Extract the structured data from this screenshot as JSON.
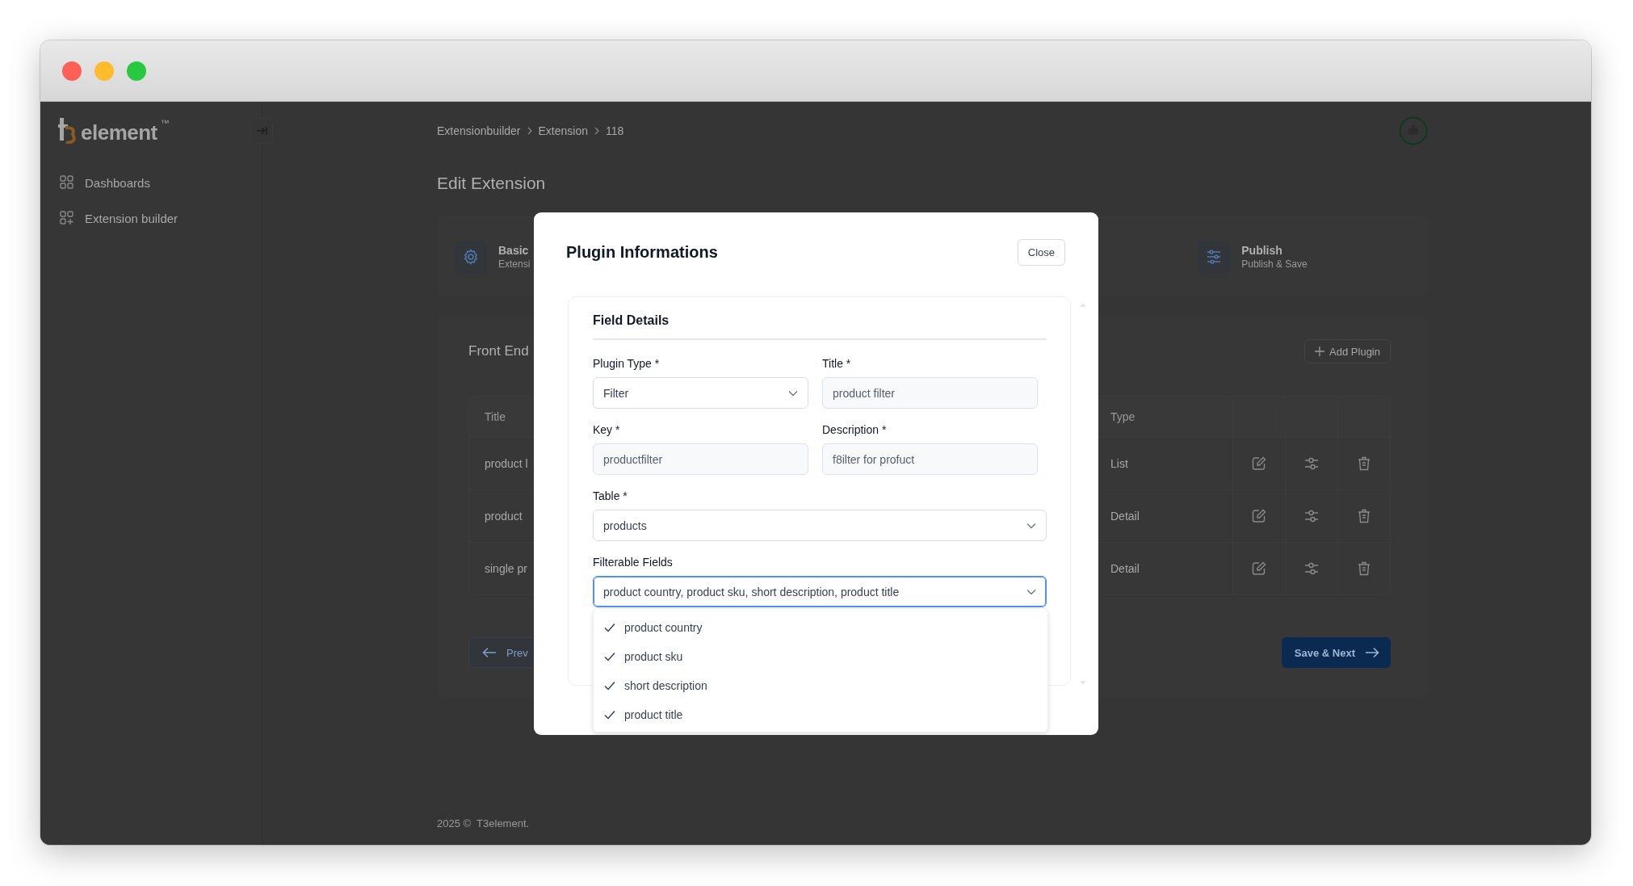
{
  "window": {
    "controls": [
      {
        "color": "#fe5f57"
      },
      {
        "color": "#febc2e"
      },
      {
        "color": "#28c840"
      }
    ]
  },
  "sidebar": {
    "logo": {
      "text": "element",
      "mark": "™"
    },
    "items": [
      {
        "label": "Dashboards",
        "kind": "grid"
      },
      {
        "label": "Extension builder",
        "kind": "grid-plus"
      }
    ]
  },
  "breadcrumb": [
    "Extensionbuilder",
    "Extension",
    "118"
  ],
  "page_title": "Edit Extension",
  "steps": [
    {
      "title": "Basic",
      "subtitle": "Extensi",
      "kind": "gear"
    },
    {
      "title": "Publish",
      "subtitle": "Publish & Save",
      "kind": "sliders"
    }
  ],
  "plugins": {
    "heading": "Front End",
    "add_button": "Add Plugin",
    "columns": [
      "Title",
      "Type"
    ],
    "rows": [
      {
        "title": "product l",
        "type": "List"
      },
      {
        "title": "product",
        "type": "Detail"
      },
      {
        "title": "single pr",
        "type": "Detail"
      }
    ],
    "previous_button": "Prev",
    "next_button": "Save & Next"
  },
  "footer": "2025 ©  T3element.",
  "modal": {
    "title": "Plugin Informations",
    "close_button": "Close",
    "section": "Field Details",
    "fields": [
      {
        "label": "Plugin Type *",
        "kind": "select",
        "value": "Filter"
      },
      {
        "label": "Title *",
        "kind": "input",
        "value": "product filter",
        "readonly": true
      },
      {
        "label": "Key *",
        "kind": "input",
        "value": "productfilter",
        "readonly": true
      },
      {
        "label": "Description *",
        "kind": "input",
        "value": "f8ilter for profuct",
        "readonly": true
      },
      {
        "label": "Table *",
        "kind": "wide-select",
        "value": "products"
      },
      {
        "label": "Filterable Fields",
        "kind": "wide-select",
        "value": "product country, product sku, short description, product title",
        "focused": true
      }
    ],
    "dropdown": [
      {
        "label": "product country",
        "checked": true
      },
      {
        "label": "product sku",
        "checked": true
      },
      {
        "label": "short description",
        "checked": true
      },
      {
        "label": "product title",
        "checked": true
      }
    ]
  }
}
